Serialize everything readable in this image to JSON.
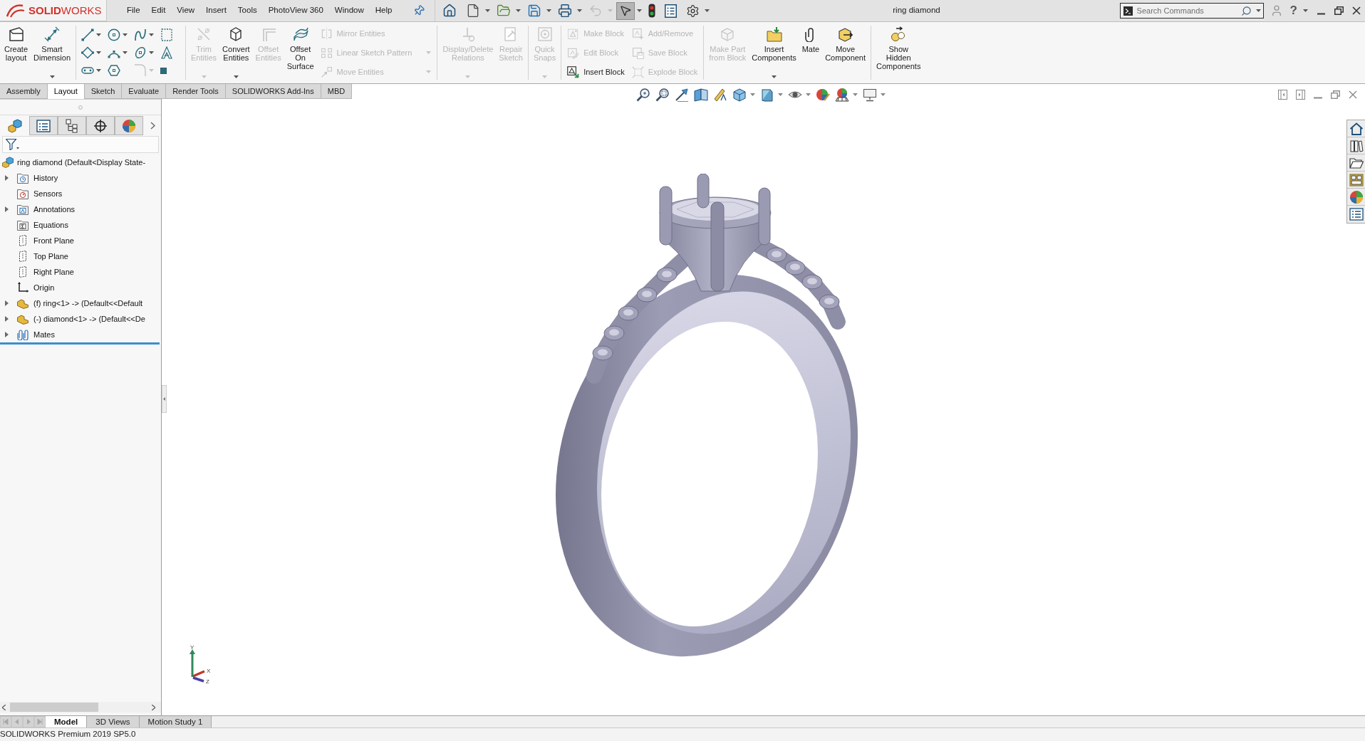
{
  "title_bar": {
    "logo": "**SOLID**WORKS",
    "menu": [
      "File",
      "Edit",
      "View",
      "Insert",
      "Tools",
      "PhotoView 360",
      "Window",
      "Help"
    ],
    "quick_access": [
      {
        "dropdown": false,
        "disabled": false,
        "pressed": false
      },
      {
        "dropdown": true,
        "disabled": false,
        "pressed": false
      },
      {
        "dropdown": true,
        "disabled": false,
        "pressed": false
      },
      {
        "dropdown": true,
        "disabled": false,
        "pressed": false
      },
      {
        "dropdown": true,
        "disabled": false,
        "pressed": false
      },
      {
        "dropdown": true,
        "disabled": true,
        "pressed": false
      },
      {
        "dropdown": true,
        "disabled": false,
        "pressed": true
      },
      {
        "dropdown": false,
        "disabled": false,
        "pressed": false
      },
      {
        "dropdown": false,
        "disabled": false,
        "pressed": false
      },
      {
        "dropdown": true,
        "disabled": false,
        "pressed": false
      }
    ],
    "document_title": "ring diamond",
    "search": {
      "placeholder": "Search Commands"
    },
    "help": "?"
  },
  "command_manager": {
    "groups": [
      {
        "columns": [
          {
            "kind": "large",
            "label": "Create\nlayout",
            "disabled": false,
            "dropdown": false
          },
          {
            "kind": "large",
            "label": "Smart\nDimension",
            "disabled": false,
            "dropdown": true
          }
        ]
      },
      {
        "columns": [
          {
            "kind": "grid",
            "tools": [
              {
                "disabled": false,
                "dropdown": true
              },
              {
                "disabled": false,
                "dropdown": true
              },
              {
                "disabled": false,
                "dropdown": true
              },
              {
                "disabled": false,
                "dropdown": false
              },
              {
                "disabled": false,
                "dropdown": true
              },
              {
                "disabled": false,
                "dropdown": true
              },
              {
                "disabled": false,
                "dropdown": true
              },
              {
                "disabled": false,
                "dropdown": false
              },
              {
                "disabled": false,
                "dropdown": true
              },
              {
                "disabled": false,
                "dropdown": false
              },
              {
                "disabled": true,
                "dropdown": true
              },
              {
                "disabled": false,
                "dropdown": false
              }
            ]
          }
        ]
      },
      {
        "columns": [
          {
            "kind": "large",
            "label": "Trim\nEntities",
            "disabled": true,
            "dropdown": true
          },
          {
            "kind": "large",
            "label": "Convert\nEntities",
            "disabled": false,
            "dropdown": true
          },
          {
            "kind": "large",
            "label": "Offset\nEntities",
            "disabled": true,
            "dropdown": false
          },
          {
            "kind": "large",
            "label": "Offset\nOn\nSurface",
            "disabled": false,
            "dropdown": false
          },
          {
            "kind": "stack",
            "commands": [
              {
                "label": "Mirror Entities",
                "disabled": true,
                "dropdown": false
              },
              {
                "label": "Linear Sketch Pattern",
                "disabled": true,
                "dropdown": true
              },
              {
                "label": "Move Entities",
                "disabled": true,
                "dropdown": true
              }
            ]
          }
        ]
      },
      {
        "columns": [
          {
            "kind": "large",
            "label": "Display/Delete\nRelations",
            "disabled": true,
            "dropdown": true
          },
          {
            "kind": "large",
            "label": "Repair\nSketch",
            "disabled": true,
            "dropdown": false
          }
        ]
      },
      {
        "columns": [
          {
            "kind": "large",
            "label": "Quick\nSnaps",
            "disabled": true,
            "dropdown": true
          }
        ]
      },
      {
        "columns": [
          {
            "kind": "stack",
            "commands": [
              {
                "label": "Make Block",
                "disabled": true,
                "dropdown": false
              },
              {
                "label": "Edit Block",
                "disabled": true,
                "dropdown": false
              },
              {
                "label": "Insert Block",
                "disabled": false,
                "dropdown": false
              }
            ]
          },
          {
            "kind": "stack",
            "commands": [
              {
                "label": "Add/Remove",
                "disabled": true,
                "dropdown": false
              },
              {
                "label": "Save Block",
                "disabled": true,
                "dropdown": false
              },
              {
                "label": "Explode Block",
                "disabled": true,
                "dropdown": false
              }
            ]
          }
        ]
      },
      {
        "columns": [
          {
            "kind": "large",
            "label": "Make Part\nfrom Block",
            "disabled": true,
            "dropdown": false
          },
          {
            "kind": "large",
            "label": "Insert\nComponents",
            "disabled": false,
            "dropdown": true
          },
          {
            "kind": "large",
            "label": "Mate",
            "disabled": false,
            "dropdown": false
          },
          {
            "kind": "large",
            "label": "Move\nComponent",
            "disabled": false,
            "dropdown": false
          }
        ]
      },
      {
        "columns": [
          {
            "kind": "large",
            "label": "Show\nHidden\nComponents",
            "disabled": false,
            "dropdown": false
          }
        ]
      }
    ]
  },
  "tabs": [
    {
      "label": "Assembly",
      "selected": false
    },
    {
      "label": "Layout",
      "selected": true
    },
    {
      "label": "Sketch",
      "selected": false
    },
    {
      "label": "Evaluate",
      "selected": false
    },
    {
      "label": "Render Tools",
      "selected": false
    },
    {
      "label": "SOLIDWORKS Add-Ins",
      "selected": false
    },
    {
      "label": "MBD",
      "selected": false
    }
  ],
  "feature_tree": {
    "panel_tabs": [
      {
        "selected": true
      },
      {
        "selected": false
      },
      {
        "selected": false
      },
      {
        "selected": false
      },
      {
        "selected": false
      }
    ],
    "root": {
      "kind": "assembly",
      "label": "ring diamond (Default<Display State-",
      "children": [
        {
          "kind": "history",
          "label": "History",
          "collapsed": true
        },
        {
          "kind": "sensors",
          "label": "Sensors",
          "collapsed": false
        },
        {
          "kind": "annotations",
          "label": "Annotations",
          "collapsed": true
        },
        {
          "kind": "equations",
          "label": "Equations",
          "collapsed": false
        },
        {
          "kind": "plane",
          "label": "Front Plane",
          "collapsed": false
        },
        {
          "kind": "plane",
          "label": "Top Plane",
          "collapsed": false
        },
        {
          "kind": "plane",
          "label": "Right Plane",
          "collapsed": false
        },
        {
          "kind": "origin",
          "label": "Origin",
          "collapsed": false
        },
        {
          "kind": "part",
          "label": "(f) ring<1> -> (Default<<Default",
          "collapsed": true
        },
        {
          "kind": "part",
          "label": "(-) diamond<1> -> (Default<<De",
          "collapsed": true
        },
        {
          "kind": "mates",
          "label": "Mates",
          "collapsed": true
        }
      ]
    }
  },
  "view_triad": {
    "axes": [
      "Y",
      "X",
      "Z"
    ]
  },
  "bottom_tabs": [
    {
      "label": "Model",
      "selected": true
    },
    {
      "label": "3D Views",
      "selected": false
    },
    {
      "label": "Motion Study 1",
      "selected": false
    }
  ],
  "status_bar": "SOLIDWORKS Premium 2019 SP5.0"
}
